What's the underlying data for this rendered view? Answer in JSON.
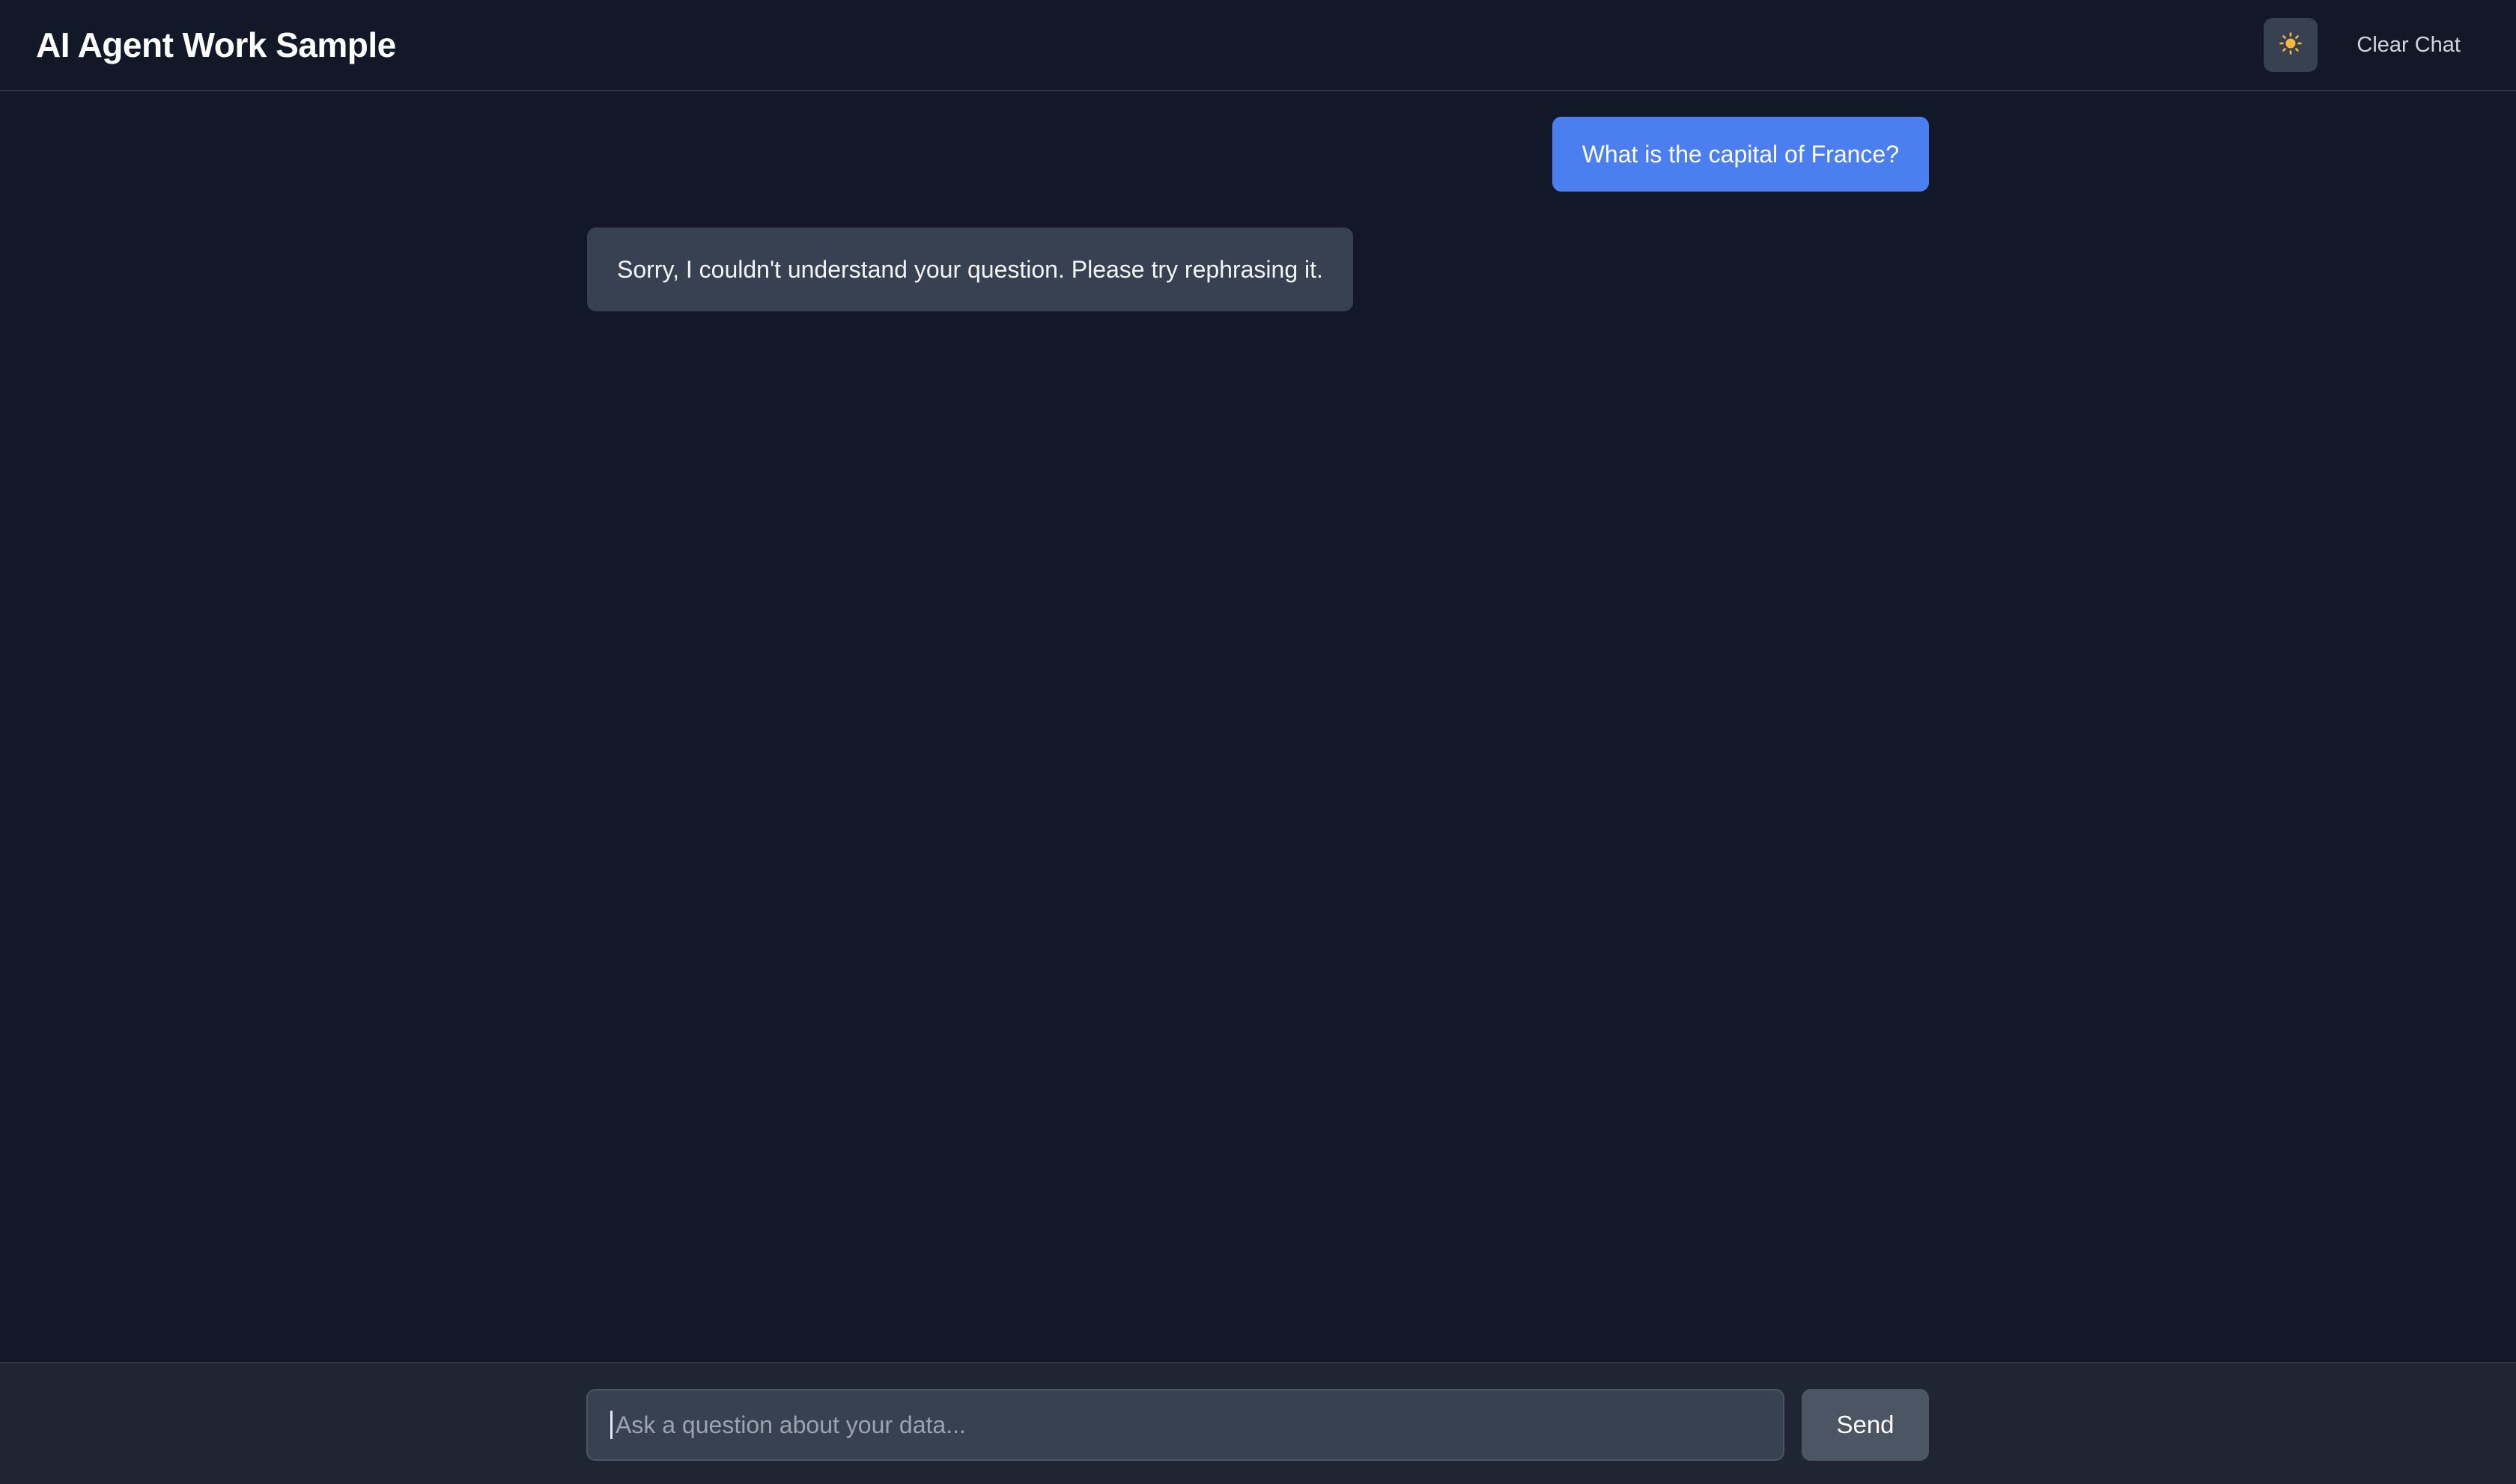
{
  "header": {
    "title": "AI Agent Work Sample",
    "theme_toggle_icon": "sun-icon",
    "clear_label": "Clear Chat"
  },
  "messages": [
    {
      "role": "user",
      "text": "What is the capital of France?"
    },
    {
      "role": "assistant",
      "text": "Sorry, I couldn't understand your question. Please try rephrasing it."
    }
  ],
  "composer": {
    "placeholder": "Ask a question about your data...",
    "value": "",
    "send_label": "Send"
  },
  "colors": {
    "background": "#131828",
    "footer": "#1f2532",
    "user_bubble": "#4b7ff0",
    "assistant_bubble": "#374151",
    "sun": "#f5b942"
  }
}
